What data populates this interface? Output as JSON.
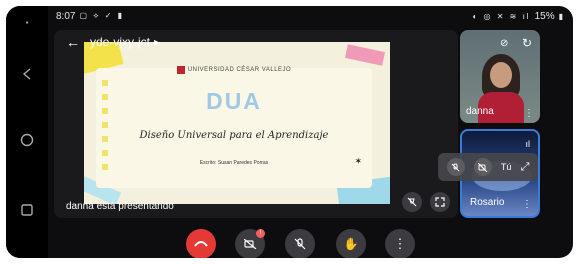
{
  "status": {
    "time": "8:07",
    "battery": "15%"
  },
  "meeting": {
    "code": "yde-vjxy-jct",
    "presenting_text": "danna está presentando"
  },
  "slide": {
    "university": "UNIVERSIDAD CÉSAR VALLEJO",
    "title": "DUA",
    "subtitle": "Diseño Universal para el Aprendizaje",
    "author": "Escrito: Susan Paredes Porras"
  },
  "participants": [
    {
      "name": "danna"
    },
    {
      "name": "Rosario"
    }
  ],
  "overlay": {
    "you_label": "Tú"
  },
  "colors": {
    "end_call": "#e53935",
    "badge": "#f06060",
    "speaking_border": "#3a7bd5",
    "slide_yellow": "#f3e24a",
    "slide_pink": "#f09ab8"
  }
}
